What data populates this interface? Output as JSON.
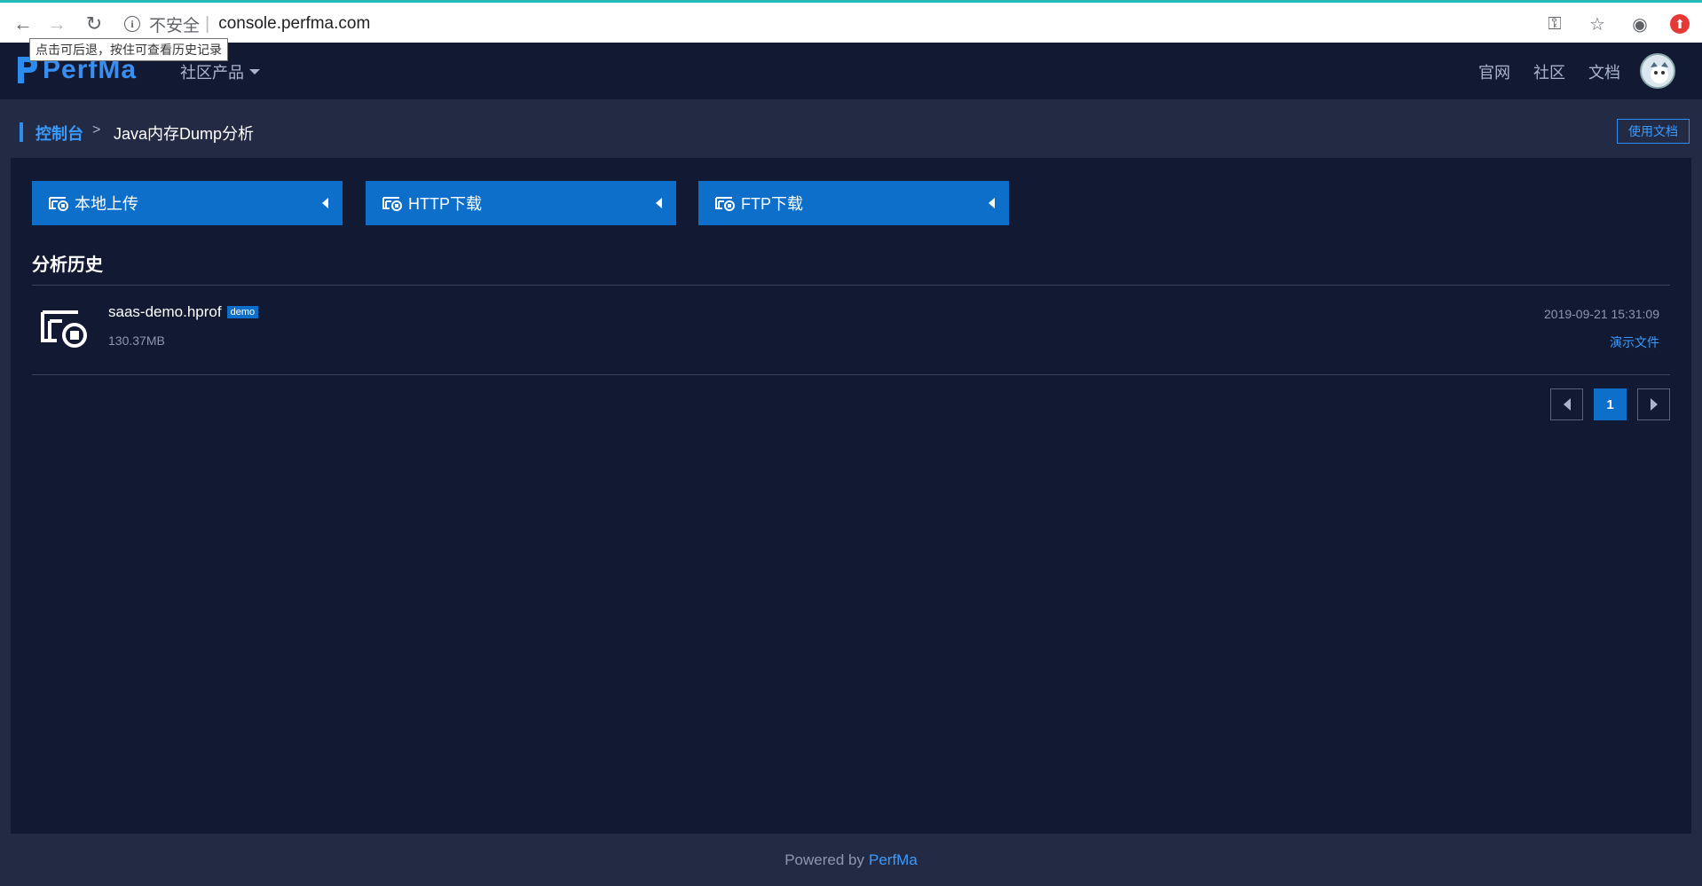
{
  "browser": {
    "insecure_label": "不安全",
    "url": "console.perfma.com",
    "back_tooltip": "点击可后退，按住可查看历史记录"
  },
  "header": {
    "logo_text": "PerfMa",
    "product_menu": "社区产品",
    "links": [
      "官网",
      "社区",
      "文档"
    ]
  },
  "breadcrumb": {
    "home": "控制台",
    "separator": ">",
    "current": "Java内存Dump分析",
    "doc_button": "使用文档"
  },
  "upload": {
    "buttons": [
      {
        "label": "本地上传"
      },
      {
        "label": "HTTP下载"
      },
      {
        "label": "FTP下载"
      }
    ]
  },
  "history": {
    "title": "分析历史",
    "items": [
      {
        "name": "saas-demo.hprof",
        "badge": "demo",
        "size": "130.37MB",
        "time": "2019-09-21 15:31:09",
        "type": "演示文件"
      }
    ]
  },
  "pagination": {
    "current": "1"
  },
  "footer": {
    "prefix": "Powered by",
    "brand": "PerfMa"
  },
  "colors": {
    "accent": "#0e6fcb",
    "link": "#3a9bff",
    "background": "#121a33"
  }
}
